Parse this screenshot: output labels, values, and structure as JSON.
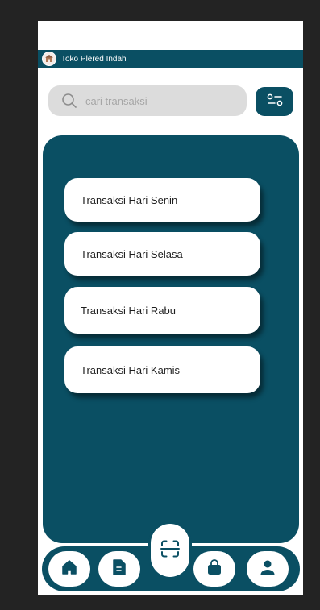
{
  "store": {
    "name": "Toko Plered Indah",
    "logo_icon": "store-logo-icon"
  },
  "search": {
    "placeholder": "cari transaksi",
    "value": "",
    "icon": "search-icon"
  },
  "filter": {
    "icon": "filter-sliders-icon"
  },
  "transactions": [
    {
      "label": "Transaksi Hari Senin"
    },
    {
      "label": "Transaksi Hari Selasa"
    },
    {
      "label": "Transaksi Hari Rabu"
    },
    {
      "label": "Transaksi Hari Kamis"
    }
  ],
  "nav": {
    "items": [
      {
        "icon": "home-icon"
      },
      {
        "icon": "document-icon"
      },
      {
        "icon": "scan-icon"
      },
      {
        "icon": "shopping-bag-icon"
      },
      {
        "icon": "user-icon"
      }
    ]
  },
  "colors": {
    "primary": "#0a4f63",
    "search_bg": "#dcdcdc",
    "card_bg": "#ffffff",
    "outer_bg": "#232323"
  }
}
